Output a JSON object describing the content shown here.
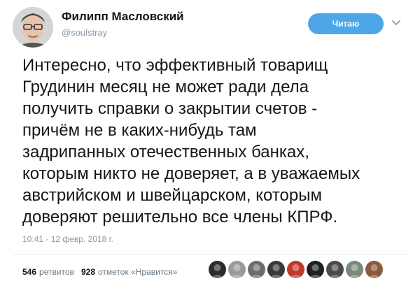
{
  "author": {
    "name": "Филипп Масловский",
    "handle": "@soulstray"
  },
  "follow_button": {
    "label": "Читаю"
  },
  "menu_icon": "chevron-down-icon",
  "tweet": {
    "lines": [
      "Интересно, что эффективный товарищ",
      "Грудинин месяц не может ради дела",
      "получить справки о закрытии счетов -",
      "причём не в каких-нибудь там",
      "задрипанных отечественных банках,",
      "которым никто не доверяет, а в уважаемых",
      "австрийском и швейцарском, которым",
      "доверяют решительно все члены КПРФ."
    ],
    "timestamp": "10:41 - 12 февр. 2018 г."
  },
  "stats": {
    "retweets_count": "546",
    "retweets_label": "ретвитов",
    "likes_count": "928",
    "likes_label": "отметок «Нравится»"
  },
  "likers": [
    {
      "name": "liker-avatar-1",
      "color": "#2b2b2b"
    },
    {
      "name": "liker-avatar-2",
      "color": "#9a9a9a"
    },
    {
      "name": "liker-avatar-3",
      "color": "#6d6d6d"
    },
    {
      "name": "liker-avatar-4",
      "color": "#3a3a3a"
    },
    {
      "name": "liker-avatar-5",
      "color": "#c0392b"
    },
    {
      "name": "liker-avatar-6",
      "color": "#1f1f1f"
    },
    {
      "name": "liker-avatar-7",
      "color": "#4a4a4a"
    },
    {
      "name": "liker-avatar-8",
      "color": "#7a8a7a"
    },
    {
      "name": "liker-avatar-9",
      "color": "#8a5a3a"
    }
  ],
  "colors": {
    "accent": "#4ea6ea",
    "secondary_text": "#8a9aa8"
  }
}
